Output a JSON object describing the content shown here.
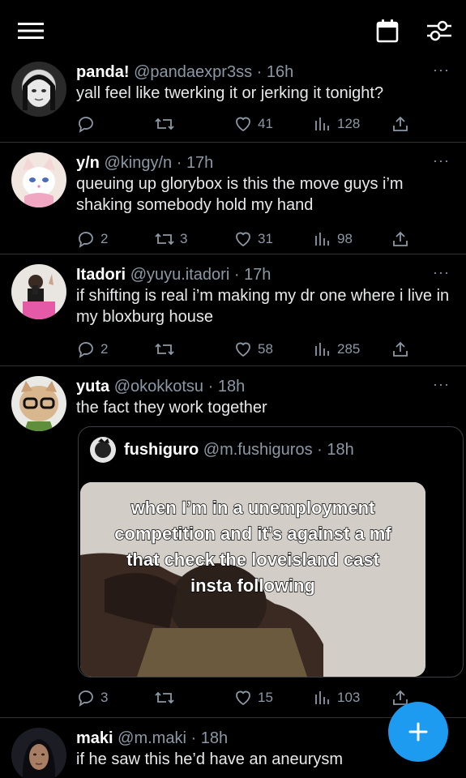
{
  "header": {
    "menu_icon": "hamburger-menu-icon",
    "calendar_icon": "calendar-icon",
    "filter_icon": "sliders-icon"
  },
  "colors": {
    "background": "#000000",
    "text": "#e7e9ea",
    "muted": "#8b98a5",
    "divider": "#2f3336",
    "accent": "#1d9bf0"
  },
  "tweets": [
    {
      "name": "panda!",
      "handle": "@pandaexpr3ss",
      "sep": "·",
      "time": "16h",
      "text": "yall feel like twerking it or jerking it tonight?",
      "reply_count": "",
      "retweet_count": "",
      "like_count": "41",
      "view_count": "128"
    },
    {
      "name": "y/n",
      "handle": "@kingy/n",
      "sep": "·",
      "time": "17h",
      "text": "queuing up glorybox is this the move guys i’m shaking somebody hold my hand",
      "reply_count": "2",
      "retweet_count": "3",
      "like_count": "31",
      "view_count": "98"
    },
    {
      "name": "Itadori",
      "handle": "@yuyu.itadori",
      "sep": "·",
      "time": "17h",
      "text": "if shifting is real i’m making my dr one where i live in my bloxburg house",
      "reply_count": "2",
      "retweet_count": "",
      "like_count": "58",
      "view_count": "285"
    },
    {
      "name": "yuta",
      "handle": "@okokkotsu",
      "sep": "·",
      "time": "18h",
      "text": "the fact they work together",
      "reply_count": "3",
      "retweet_count": "",
      "like_count": "15",
      "view_count": "103",
      "quote": {
        "name": "fushiguro",
        "handle": "@m.fushiguros",
        "sep": "·",
        "time": "18h",
        "caption": [
          "when I’m in a unemployment",
          "competition and it’s against a mf",
          "that check the loveisland cast",
          "insta following"
        ]
      }
    },
    {
      "name": "maki",
      "handle": "@m.maki",
      "sep": "·",
      "time": "18h",
      "text": "if he saw this he’d have an aneurysm"
    }
  ],
  "more_label": "···",
  "fab": {
    "icon": "plus-icon"
  }
}
